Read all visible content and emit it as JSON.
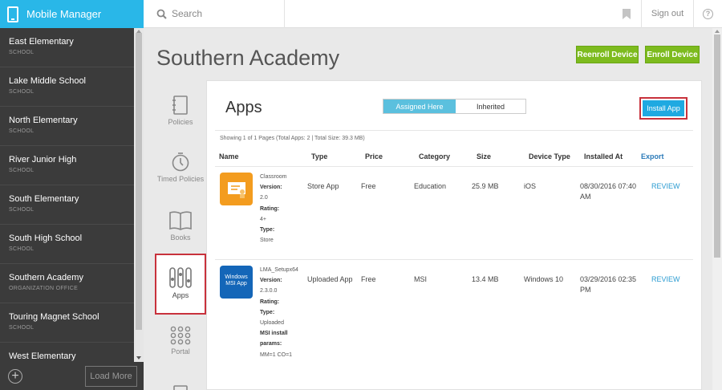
{
  "app": {
    "title": "Mobile Manager"
  },
  "search": {
    "placeholder": "Search"
  },
  "header": {
    "signout": "Sign out"
  },
  "sidebar": {
    "items": [
      {
        "name": "East Elementary",
        "type": "SCHOOL"
      },
      {
        "name": "Lake Middle School",
        "type": "SCHOOL"
      },
      {
        "name": "North Elementary",
        "type": "SCHOOL"
      },
      {
        "name": "River Junior High",
        "type": "SCHOOL"
      },
      {
        "name": "South Elementary",
        "type": "SCHOOL"
      },
      {
        "name": "South High School",
        "type": "SCHOOL"
      },
      {
        "name": "Southern Academy",
        "type": "ORGANIZATION OFFICE"
      },
      {
        "name": "Touring Magnet School",
        "type": "SCHOOL"
      },
      {
        "name": "West Elementary",
        "type": "SCHOOL"
      }
    ],
    "load_more": "Load More"
  },
  "page": {
    "title": "Southern Academy",
    "reenroll": "Reenroll Device",
    "enroll": "Enroll Device"
  },
  "nav": {
    "policies": "Policies",
    "timed_policies": "Timed Policies",
    "books": "Books",
    "apps": "Apps",
    "portal": "Portal"
  },
  "panel": {
    "heading": "Apps",
    "tab_assigned": "Assigned Here",
    "tab_inherited": "Inherited",
    "install": "Install App",
    "showing": "Showing 1 of 1 Pages (Total Apps: 2 | Total Size: 39.3 MB)",
    "columns": [
      "Name",
      "Type",
      "Price",
      "Category",
      "Size",
      "Device Type",
      "Installed At",
      "Export"
    ],
    "rows": [
      {
        "icon_text": "",
        "name": "Classroom",
        "version_label": "Version:",
        "version": "2.0",
        "rating_label": "Rating:",
        "rating": "4+",
        "type_label": "Type:",
        "type_value": "Store",
        "type": "Store App",
        "price": "Free",
        "category": "Education",
        "size": "25.9 MB",
        "device": "iOS",
        "installed": "08/30/2016 07:40 AM",
        "action": "REVIEW"
      },
      {
        "icon_text": "Windows MSI App",
        "name": "LMA_Setupx64",
        "version_label": "Version:",
        "version": "2.3.0.0",
        "rating_label": "Rating:",
        "type_label": "Type:",
        "type_value": "Uploaded",
        "params_label": "MSI install params:",
        "params": "MM=1 CO=1",
        "type": "Uploaded App",
        "price": "Free",
        "category": "MSI",
        "size": "13.4 MB",
        "device": "Windows 10",
        "installed": "03/29/2016 02:35 PM",
        "action": "REVIEW"
      }
    ]
  },
  "colors": {
    "brand": "#29b7e8",
    "green": "#7dbb1e",
    "highlight": "#c8323c",
    "link": "#2a9bd1"
  }
}
